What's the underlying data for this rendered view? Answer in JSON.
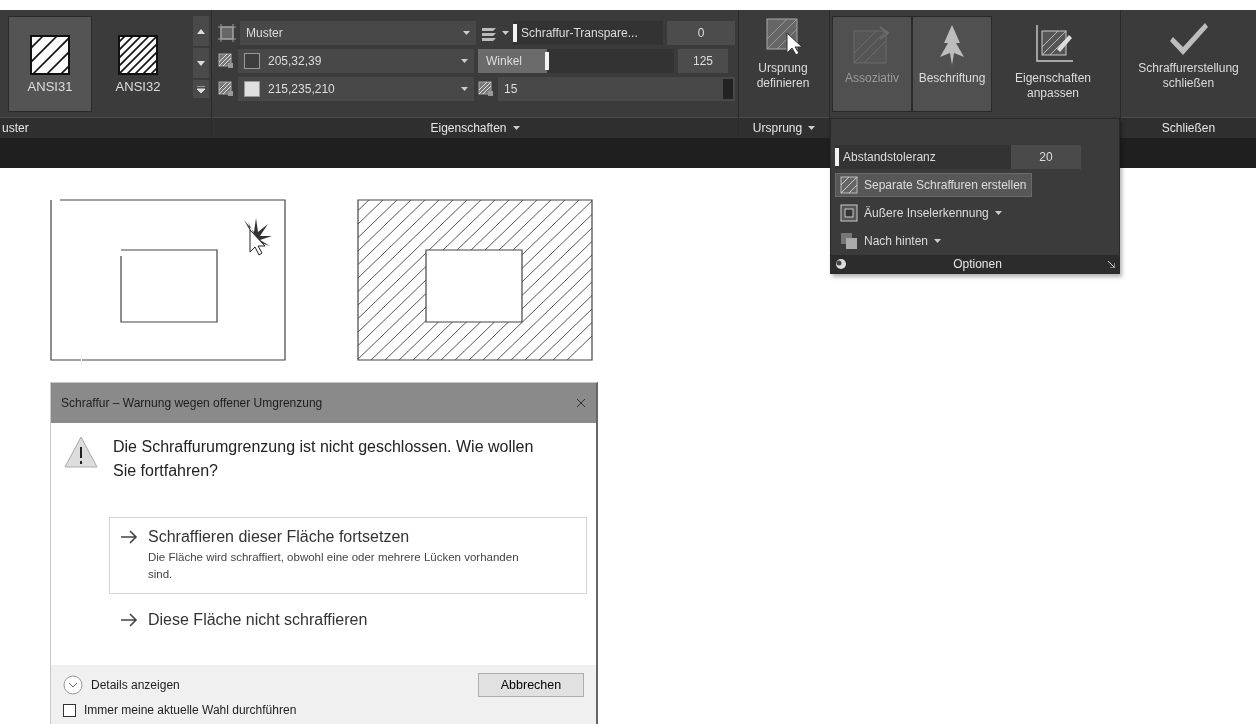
{
  "ribbon": {
    "pattern_panel": {
      "title": "uster",
      "patterns": [
        {
          "label": "ANSI31",
          "selected": true,
          "kind": "wide"
        },
        {
          "label": "ANSI32",
          "selected": false,
          "kind": "dense"
        }
      ]
    },
    "properties_panel": {
      "title": "Eigenschaften",
      "hatch_type": "Muster",
      "pattern_color": "205,32,39",
      "background_color": "215,235,210",
      "transparency": {
        "label": "Schraffur-Transpare...",
        "value": "0",
        "level": 0
      },
      "angle": {
        "label": "Winkel",
        "value": "125",
        "level": 0.35
      },
      "scale": "15"
    },
    "origin_panel": {
      "title": "Ursprung",
      "button": "Ursprung definieren"
    },
    "options_panel": {
      "buttons": [
        {
          "label": "Assoziativ",
          "selected": true,
          "disabled": true,
          "kind": "associative"
        },
        {
          "label": "Beschriftung",
          "selected": true,
          "disabled": false,
          "kind": "annotative"
        },
        {
          "label": "Eigenschaften anpassen",
          "selected": false,
          "disabled": false,
          "kind": "match"
        }
      ],
      "flyout": {
        "tolerance": {
          "label": "Abstandstoleranz",
          "value": "20",
          "level": 0
        },
        "items": [
          {
            "label": "Separate Schraffuren erstellen",
            "selected": true,
            "kind": "separate"
          },
          {
            "label": "Äußere Inselerkennung",
            "selected": false,
            "kind": "island"
          },
          {
            "label": "Nach hinten",
            "selected": false,
            "kind": "order"
          }
        ],
        "title": "Optionen"
      }
    },
    "close_panel": {
      "title": "Schließen",
      "button": "Schraffurerstellung schließen"
    }
  },
  "dialog": {
    "title": "Schraffur – Warnung wegen offener Umgrenzung",
    "message": "Die Schraffurumgrenzung ist nicht geschlossen. Wie wollen Sie fortfahren?",
    "choices": [
      {
        "title": "Schraffieren dieser Fläche fortsetzen",
        "description": "Die Fläche wird schraffiert, obwohl eine oder mehrere Lücken vorhanden sind.",
        "selected": true
      },
      {
        "title": "Diese Fläche nicht schraffieren",
        "selected": false
      }
    ],
    "details": "Details anzeigen",
    "cancel": "Abbrechen",
    "remember": {
      "label": "Immer meine aktuelle Wahl durchführen",
      "checked": false
    }
  }
}
